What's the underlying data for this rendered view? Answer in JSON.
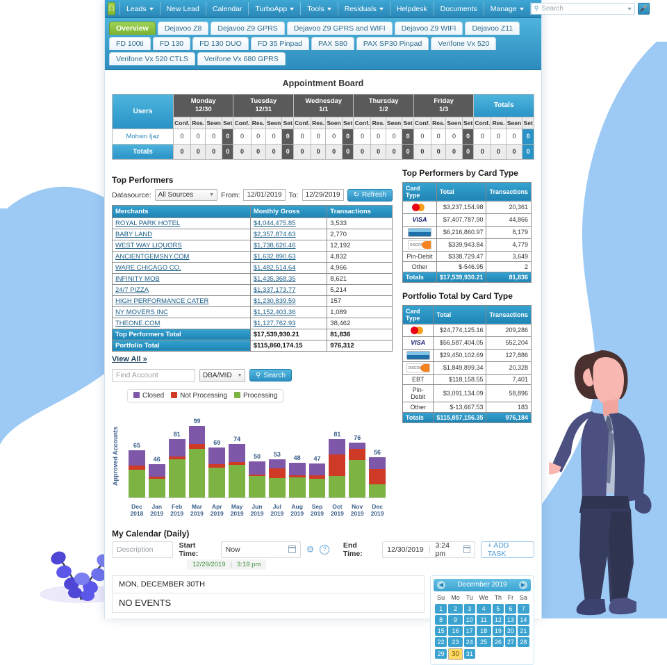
{
  "topnav": {
    "home_icon": "home-icon",
    "items": [
      {
        "label": "Leads",
        "caret": true
      },
      {
        "label": "New Lead",
        "caret": false
      },
      {
        "label": "Calendar",
        "caret": false
      },
      {
        "label": "TurboApp",
        "caret": true
      },
      {
        "label": "Tools",
        "caret": true
      },
      {
        "label": "Residuals",
        "caret": true
      },
      {
        "label": "Helpdesk",
        "caret": false
      },
      {
        "label": "Documents",
        "caret": false
      },
      {
        "label": "Manage",
        "caret": true
      }
    ],
    "search_placeholder": "Search",
    "search_value": "",
    "mic_icon": "microphone-icon"
  },
  "tabs": [
    {
      "label": "Overview",
      "active": true
    },
    {
      "label": "Dejavoo Z8",
      "active": false
    },
    {
      "label": "Dejavoo Z9 GPRS",
      "active": false
    },
    {
      "label": "Dejavoo Z9 GPRS and WIFI",
      "active": false
    },
    {
      "label": "Dejavoo Z9 WIFI",
      "active": false
    },
    {
      "label": "Dejavoo Z11",
      "active": false
    },
    {
      "label": "FD 100ti",
      "active": false
    },
    {
      "label": "FD 130",
      "active": false
    },
    {
      "label": "FD 130 DUO",
      "active": false
    },
    {
      "label": "FD 35 Pinpad",
      "active": false
    },
    {
      "label": "PAX S80",
      "active": false
    },
    {
      "label": "PAX SP30 Pinpad",
      "active": false
    },
    {
      "label": "Verifone Vx 520",
      "active": false
    },
    {
      "label": "Verifone Vx 520 CTLS",
      "active": false
    },
    {
      "label": "Verifone Vx 680 GPRS",
      "active": false
    }
  ],
  "appointment_board": {
    "title": "Appointment Board",
    "users_header": "Users",
    "totals_header": "Totals",
    "days": [
      {
        "name": "Monday",
        "date": "12/30"
      },
      {
        "name": "Tuesday",
        "date": "12/31"
      },
      {
        "name": "Wednesday",
        "date": "1/1"
      },
      {
        "name": "Thursday",
        "date": "1/2"
      },
      {
        "name": "Friday",
        "date": "1/3"
      }
    ],
    "subheaders": [
      "Conf.",
      "Res.",
      "Seen",
      "Set"
    ],
    "rows": [
      {
        "user": "Mohsin Ijaz",
        "values": [
          0,
          0,
          0,
          0,
          0,
          0,
          0,
          0,
          0,
          0,
          0,
          0,
          0,
          0,
          0,
          0,
          0,
          0,
          0,
          0,
          0,
          0,
          0,
          0
        ]
      }
    ],
    "totals_row": {
      "label": "Totals",
      "values": [
        0,
        0,
        0,
        0,
        0,
        0,
        0,
        0,
        0,
        0,
        0,
        0,
        0,
        0,
        0,
        0,
        0,
        0,
        0,
        0,
        0,
        0,
        0,
        0
      ]
    }
  },
  "top_performers": {
    "title": "Top Performers",
    "datasource_label": "Datasource:",
    "datasource_value": "All Sources",
    "from_label": "From:",
    "from_value": "12/01/2019",
    "to_label": "To:",
    "to_value": "12/29/2019",
    "refresh_label": "Refresh",
    "columns": [
      "Merchants",
      "Monthly Gross",
      "Transactions"
    ],
    "rows": [
      {
        "merchant": "ROYAL PARK HOTEL",
        "gross": "$4,044,475.85",
        "tx": "3,533"
      },
      {
        "merchant": "BABY LAND",
        "gross": "$2,357,874.63",
        "tx": "2,770"
      },
      {
        "merchant": "WEST WAY LIQUORS",
        "gross": "$1,738,626.46",
        "tx": "12,192"
      },
      {
        "merchant": "ANCIENTGEMSNY.COM",
        "gross": "$1,632,890.63",
        "tx": "4,832"
      },
      {
        "merchant": "WARE CHICAGO CO.",
        "gross": "$1,482,514.64",
        "tx": "4,966"
      },
      {
        "merchant": "INFINITY MOB",
        "gross": "$1,435,368.35",
        "tx": "8,621"
      },
      {
        "merchant": "24/7 PIZZA",
        "gross": "$1,337,173.77",
        "tx": "5,214"
      },
      {
        "merchant": "HIGH PERFORMANCE CATER",
        "gross": "$1,230,839.59",
        "tx": "157"
      },
      {
        "merchant": "NY MOVERS INC",
        "gross": "$1,152,403.36",
        "tx": "1,089"
      },
      {
        "merchant": "THEONE.COM",
        "gross": "$1,127,762.93",
        "tx": "38,462"
      }
    ],
    "summary": [
      {
        "label": "Top Performers Total",
        "gross": "$17,539,930.21",
        "tx": "81,836"
      },
      {
        "label": "Portfolio Total",
        "gross": "$115,860,174.15",
        "tx": "976,312"
      }
    ],
    "view_all": "View All »"
  },
  "account_search": {
    "find_placeholder": "Find Account",
    "find_value": "",
    "type_value": "DBA/MID",
    "search_label": "Search"
  },
  "chart_data": {
    "type": "bar",
    "subtype": "stacked",
    "title": "",
    "xlabel": "",
    "ylabel": "Approved Accounts",
    "grid": false,
    "legend_position": "top-left",
    "legend": [
      {
        "name": "Closed",
        "color": "#7e57a8"
      },
      {
        "name": "Not Processing",
        "color": "#cf3a27"
      },
      {
        "name": "Processing",
        "color": "#7cb342"
      }
    ],
    "categories": [
      "Dec 2018",
      "Jan 2019",
      "Feb 2019",
      "Mar 2019",
      "Apr 2019",
      "May 2019",
      "Jun 2019",
      "Jul 2019",
      "Aug 2019",
      "Sep 2019",
      "Oct 2019",
      "Nov 2019",
      "Dec 2019"
    ],
    "totals": [
      65,
      46,
      81,
      99,
      69,
      74,
      50,
      53,
      48,
      47,
      81,
      76,
      56
    ],
    "ylim": [
      0,
      99
    ],
    "series": [
      {
        "name": "Processing",
        "color": "#7cb342",
        "values": [
          38,
          26,
          53,
          67,
          41,
          45,
          30,
          27,
          28,
          26,
          30,
          52,
          18
        ]
      },
      {
        "name": "Not Processing",
        "color": "#cf3a27",
        "values": [
          6,
          3,
          4,
          7,
          5,
          4,
          2,
          13,
          3,
          5,
          30,
          15,
          21
        ]
      },
      {
        "name": "Closed",
        "color": "#7e57a8",
        "values": [
          21,
          17,
          24,
          25,
          23,
          25,
          18,
          13,
          17,
          16,
          21,
          9,
          17
        ]
      }
    ]
  },
  "card_tables": [
    {
      "title": "Top Performers by Card Type",
      "columns": [
        "Card Type",
        "Total",
        "Transactions"
      ],
      "rows": [
        {
          "brand": "mastercard",
          "label": "",
          "total": "$3,237,154.98",
          "tx": "20,361"
        },
        {
          "brand": "visa",
          "label": "",
          "total": "$7,407,787.90",
          "tx": "44,866"
        },
        {
          "brand": "amex",
          "label": "",
          "total": "$6,216,860.97",
          "tx": "8,179"
        },
        {
          "brand": "discover",
          "label": "",
          "total": "$339,943.84",
          "tx": "4,779"
        },
        {
          "brand": "text",
          "label": "Pin-Debit",
          "total": "$338,729.47",
          "tx": "3,649"
        },
        {
          "brand": "text",
          "label": "Other",
          "total": "$-546.95",
          "tx": "2"
        }
      ],
      "totals": {
        "label": "Totals",
        "total": "$17,539,930.21",
        "tx": "81,836"
      }
    },
    {
      "title": "Portfolio Total by Card Type",
      "columns": [
        "Card Type",
        "Total",
        "Transactions"
      ],
      "rows": [
        {
          "brand": "mastercard",
          "label": "",
          "total": "$24,774,125.16",
          "tx": "209,286"
        },
        {
          "brand": "visa",
          "label": "",
          "total": "$56,587,404.05",
          "tx": "552,204"
        },
        {
          "brand": "amex",
          "label": "",
          "total": "$29,450,102.69",
          "tx": "127,886"
        },
        {
          "brand": "discover",
          "label": "",
          "total": "$1,849,899.34",
          "tx": "20,328"
        },
        {
          "brand": "text",
          "label": "EBT",
          "total": "$118,158.55",
          "tx": "7,401"
        },
        {
          "brand": "text",
          "label": "Pin-Debit",
          "total": "$3,091,134.09",
          "tx": "58,896"
        },
        {
          "brand": "text",
          "label": "Other",
          "total": "$-13,667.53",
          "tx": "183"
        }
      ],
      "totals": {
        "label": "Totals",
        "total": "$115,857,156.35",
        "tx": "976,184"
      }
    }
  ],
  "my_calendar": {
    "title": "My Calendar (Daily)",
    "description_placeholder": "Description",
    "description_value": "",
    "start_label": "Start Time:",
    "start_value": "Now",
    "now_date": "12/29/2019",
    "now_time": "3:19 pm",
    "end_label": "End Time:",
    "end_date": "12/30/2019",
    "end_time": "3:24 pm",
    "add_task_label": "+ ADD TASK",
    "gear_icon": "gear-icon",
    "help_icon": "help-icon",
    "calendar_icon": "calendar-icon"
  },
  "events": {
    "day_header": "MON, DECEMBER 30TH",
    "empty_text": "NO EVENTS"
  },
  "mini_calendar": {
    "month_label": "December 2019",
    "prev_icon": "chevron-left-icon",
    "next_icon": "chevron-right-icon",
    "weekdays": [
      "Su",
      "Mo",
      "Tu",
      "We",
      "Th",
      "Fr",
      "Sa"
    ],
    "weeks": [
      [
        "",
        "",
        "",
        "",
        "",
        "",
        ""
      ],
      [
        "1",
        "2",
        "3",
        "4",
        "5",
        "6",
        "7"
      ],
      [
        "8",
        "9",
        "10",
        "11",
        "12",
        "13",
        "14"
      ],
      [
        "15",
        "16",
        "17",
        "18",
        "19",
        "20",
        "21"
      ],
      [
        "22",
        "23",
        "24",
        "25",
        "26",
        "27",
        "28"
      ],
      [
        "29",
        "30",
        "31",
        "",
        "",
        "",
        ""
      ]
    ],
    "selected_day": "30",
    "first_row_offset": 0
  },
  "theme": {
    "accent_blue": "#2a93c6",
    "accent_green": "#7cb230",
    "header_blue": "#1f84b4",
    "bg_blob": "#9ccaf5"
  },
  "illustrations": {
    "person": "businessman-illustration",
    "plant": "plant-illustration"
  }
}
